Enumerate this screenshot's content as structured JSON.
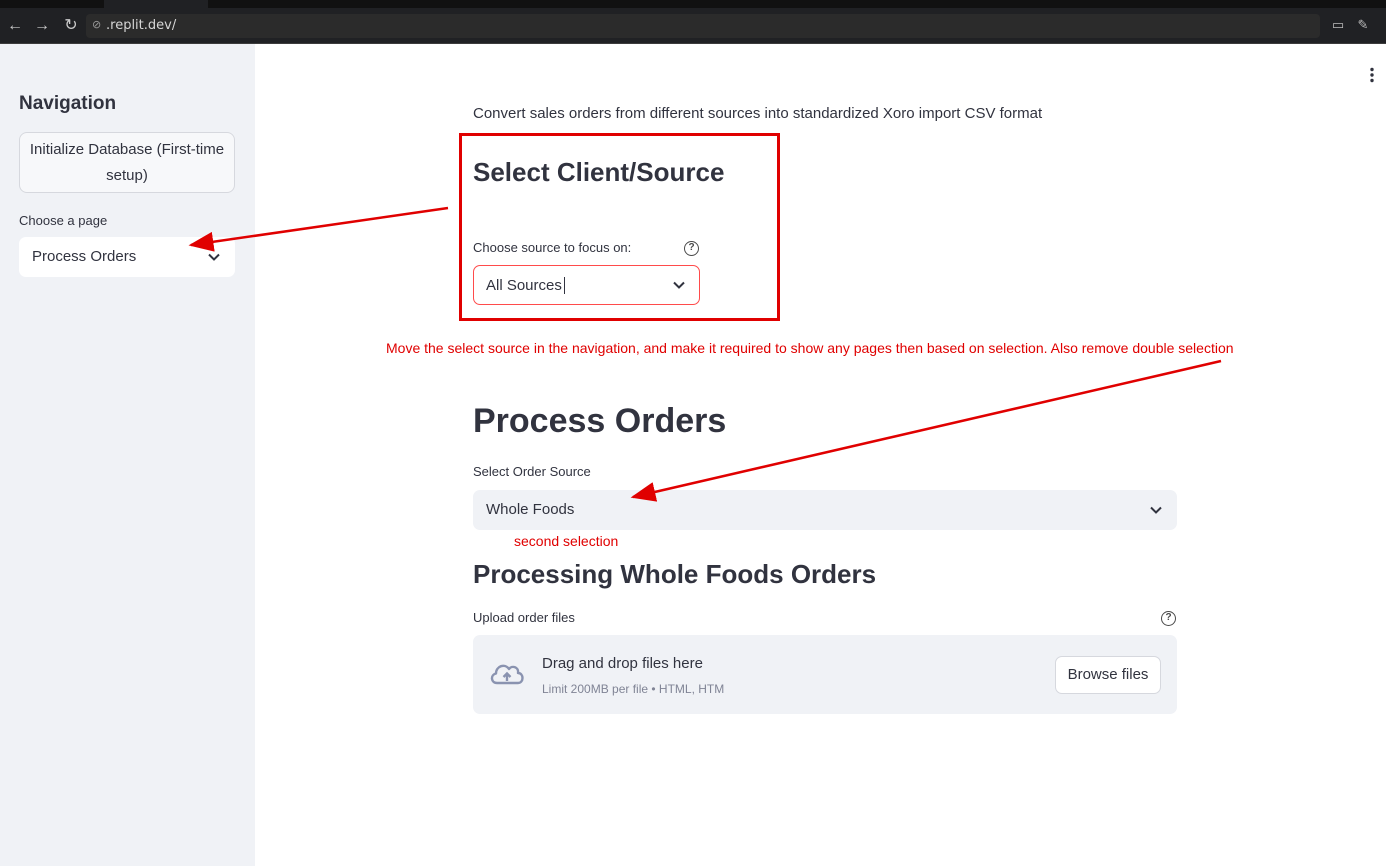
{
  "browser": {
    "url": ".replit.dev/"
  },
  "sidebar": {
    "title": "Navigation",
    "init_button": "Initialize Database (First-time setup)",
    "choose_label": "Choose a page",
    "page_select_value": "Process Orders"
  },
  "main": {
    "subtitle": "Convert sales orders from different sources into standardized Xoro import CSV format",
    "select_heading": "Select Client/Source",
    "focus_label": "Choose source to focus on:",
    "focus_value": "All Sources",
    "process_title": "Process Orders",
    "order_source_label": "Select Order Source",
    "order_source_value": "Whole Foods",
    "processing_title": "Processing Whole Foods Orders",
    "upload_label": "Upload order files",
    "dropzone_title": "Drag and drop files here",
    "dropzone_limit": "Limit 200MB per file • HTML, HTM",
    "browse_button": "Browse files"
  },
  "annotations": {
    "note_1": "Move the select source in the navigation, and make it required to show any pages then based on selection. Also remove double selection",
    "note_2": "second selection"
  },
  "colors": {
    "annotation_red": "#e00000",
    "focus_border": "#ff4b4b",
    "sidebar_bg": "#f0f2f6",
    "text": "#31333f"
  }
}
